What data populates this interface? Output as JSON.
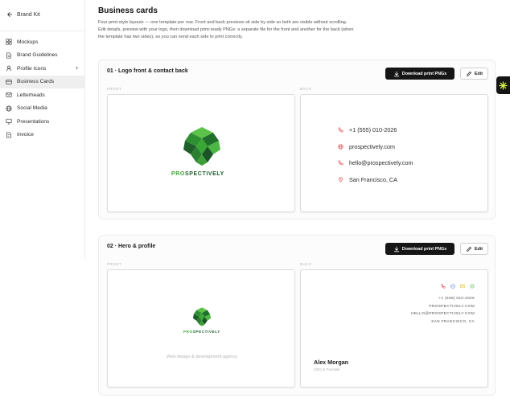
{
  "sidebar": {
    "back_label": "Brand Kit",
    "items": [
      {
        "label": "Mockups",
        "icon": "grid-icon"
      },
      {
        "label": "Brand Guidelines",
        "icon": "document-icon"
      },
      {
        "label": "Profile Icons",
        "icon": "user-icon"
      },
      {
        "label": "Business Cards",
        "icon": "card-icon",
        "active": true
      },
      {
        "label": "Letterheads",
        "icon": "mail-icon"
      },
      {
        "label": "Social Media",
        "icon": "globe-icon"
      },
      {
        "label": "Presentations",
        "icon": "monitor-icon"
      },
      {
        "label": "Invoice",
        "icon": "invoice-icon"
      }
    ],
    "plus_symbol": "+"
  },
  "page": {
    "title": "Business cards",
    "description": "Four print-style layouts — one template per row. Front and back previews sit side by side so both are visible without scrolling. Edit details, preview with your logo, then download print-ready PNGs: a separate file for the front and another for the back (when the template has two sides), so you can send each side to print correctly."
  },
  "templates": [
    {
      "title": "01 · Logo front & contact back",
      "download_label": "Download print PNGs",
      "edit_label": "Edit",
      "front_label": "FRONT",
      "back_label": "BACK",
      "brand_pro": "PRO",
      "brand_rest": "SPECTIVELY",
      "contacts": [
        {
          "icon": "phone-icon",
          "text": "+1 (555) 010-2026"
        },
        {
          "icon": "globe-icon",
          "text": "prospectively.com"
        },
        {
          "icon": "phone-icon",
          "text": "hello@prospectively.com"
        },
        {
          "icon": "location-pin-icon",
          "text": "San Francisco, CA"
        }
      ]
    },
    {
      "title": "02 · Hero & profile",
      "download_label": "Download print PNGs",
      "edit_label": "Edit",
      "front_label": "FRONT",
      "back_label": "BACK",
      "brand_pro": "PRO",
      "brand_rest": "SPECTIVELY",
      "tagline": "Web design & development agency",
      "back_lines": [
        "+1 (555) 010-2026",
        "PROSPECTIVELY.COM",
        "HELLO@PROSPECTIVELY.COM",
        "SAN FRANCISCO, CA"
      ],
      "name": "Alex Morgan",
      "role": "CEO & Founder"
    }
  ],
  "colors": {
    "accent_green": "#3aa634",
    "dark_green": "#1d5e2a",
    "icon_red": "#e0484b",
    "icon_blue": "#5b8def",
    "icon_yellow": "#e8c33a",
    "icon_green": "#4caf50"
  },
  "widget": {
    "icon": "sparkle-icon"
  }
}
